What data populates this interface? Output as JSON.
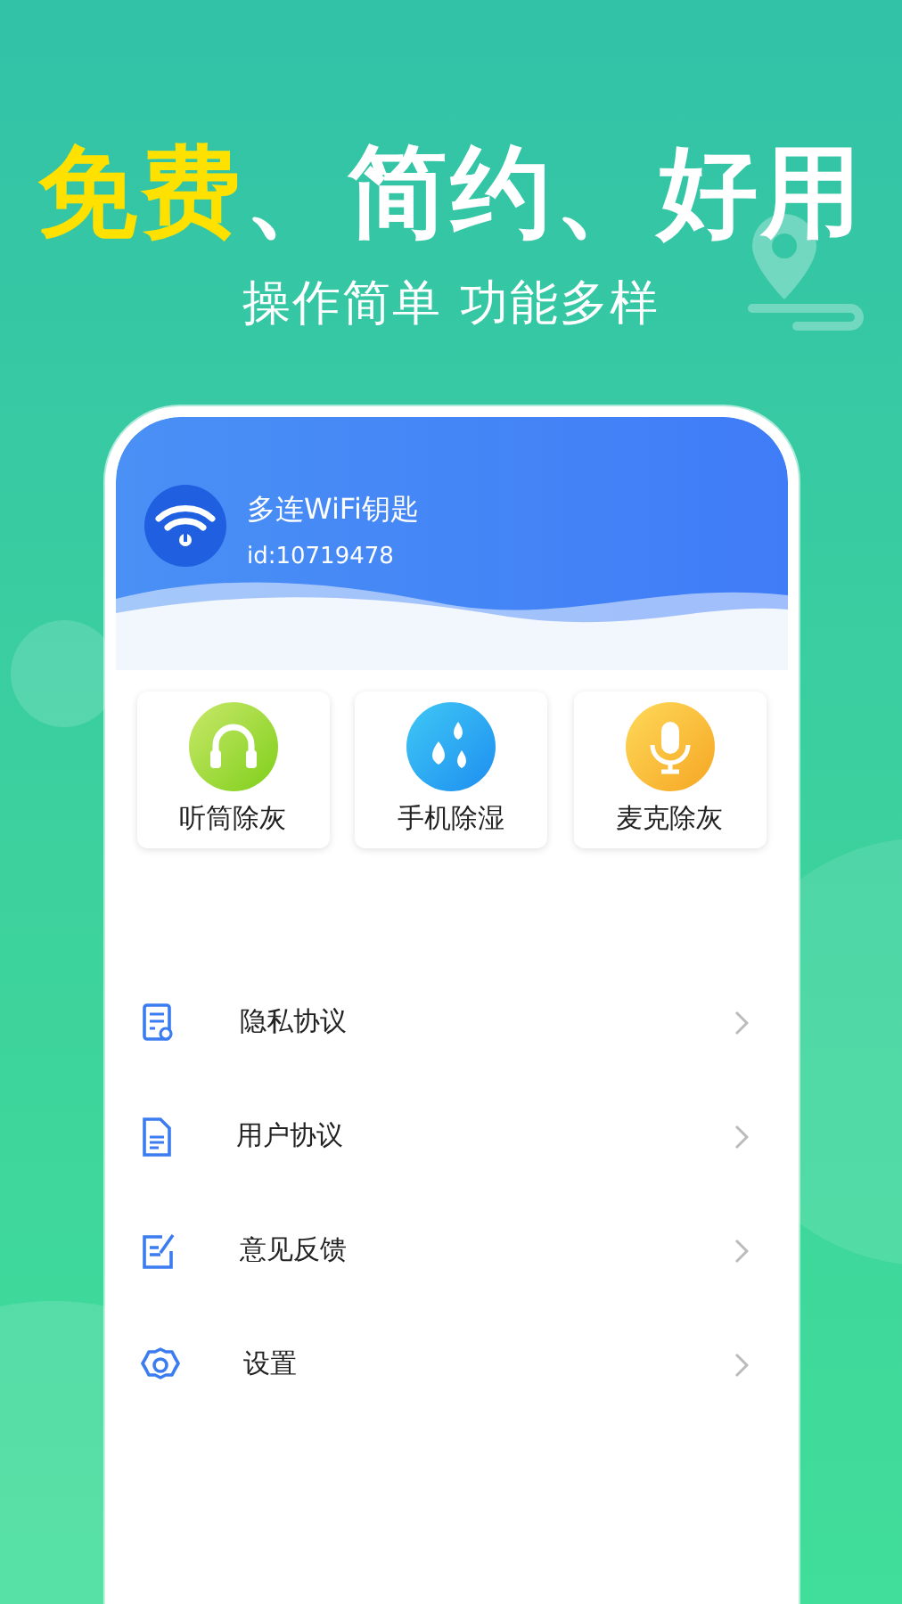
{
  "headline": [
    {
      "text": "免费",
      "highlight": true
    },
    {
      "text": "、简约、好用",
      "highlight": false
    }
  ],
  "subtitle": "操作简单 功能多样",
  "profile": {
    "name": "多连WiFi钥匙",
    "id": "id:10719478"
  },
  "tools": [
    {
      "label": "听筒除灰",
      "kind": "headphones"
    },
    {
      "label": "手机除湿",
      "kind": "drops"
    },
    {
      "label": "麦克除灰",
      "kind": "mic"
    }
  ],
  "menu": [
    {
      "label": "隐私协议",
      "kind": "privacy"
    },
    {
      "label": "用户协议",
      "kind": "document"
    },
    {
      "label": "意见反馈",
      "kind": "feedback"
    },
    {
      "label": "设置",
      "kind": "settings"
    }
  ]
}
